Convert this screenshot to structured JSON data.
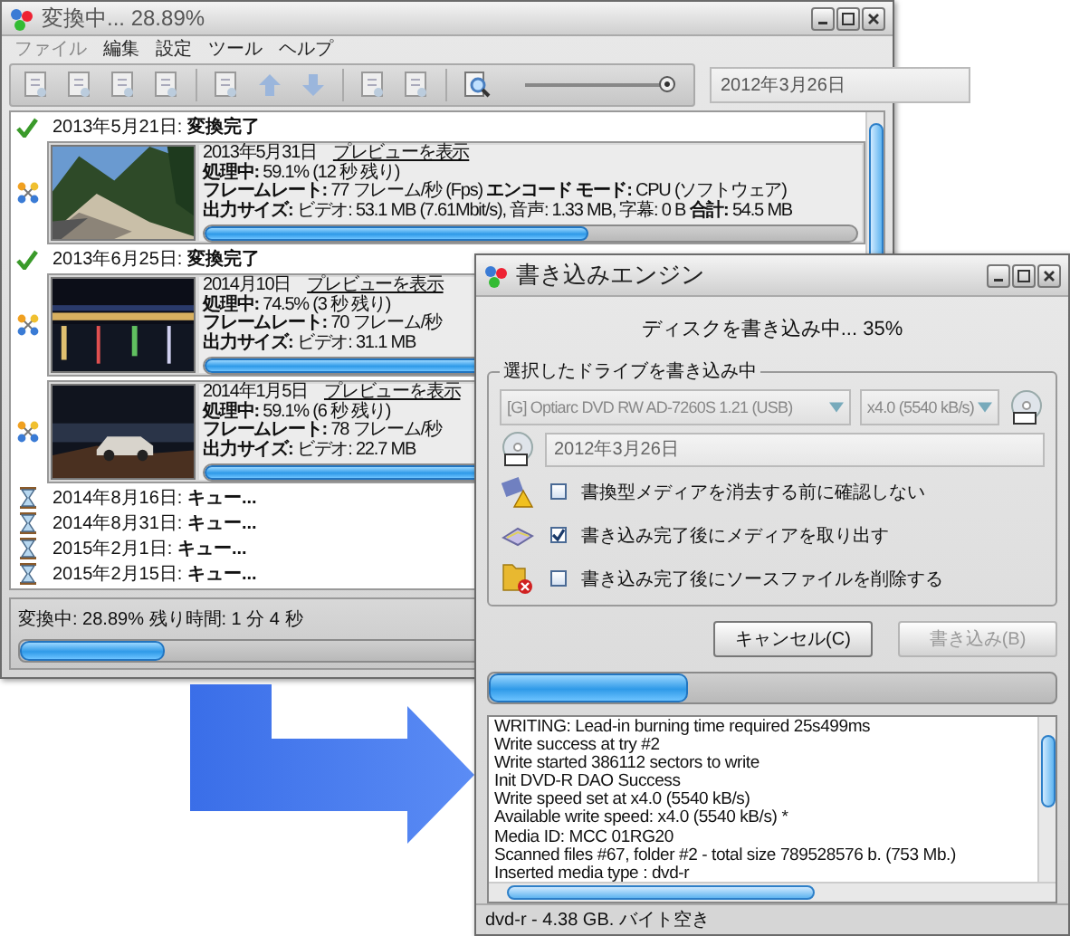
{
  "main_window": {
    "title": "変換中... 28.89%",
    "menu": [
      {
        "label": "ファイル",
        "disabled": true
      },
      {
        "label": "編集",
        "disabled": false
      },
      {
        "label": "設定",
        "disabled": false
      },
      {
        "label": "ツール",
        "disabled": false
      },
      {
        "label": "ヘルプ",
        "disabled": false
      }
    ],
    "toolbar": {
      "zoom_slider": {
        "level": 0.95
      },
      "date_field": {
        "value": "2012年3月26日"
      }
    },
    "jobs": [
      {
        "kind": "done",
        "label": "2013年5月21日: **変換完了**"
      },
      {
        "kind": "task",
        "date": "2013年5月31日",
        "link": "プレビューを表示",
        "lines": [
          "**処理中:** 59.1% (12 秒 残り)",
          "**フレームレート:** 77 フレーム/秒 (Fps) **エンコード モード:** CPU (ソフトウェア)",
          "**出力サイズ:** ビデオ: 53.1 MB (7.61Mbit/s), 音声: 1.33 MB, 字幕: 0  B **合計:** 54.5 MB"
        ],
        "level": 0.59
      },
      {
        "kind": "done",
        "label": "2013年6月25日: **変換完了**"
      },
      {
        "kind": "task",
        "date": "2014月10日",
        "link": "プレビューを表示",
        "lines": [
          "**処理中:** 74.5% (3 秒 残り)",
          "**フレームレート:** 70 フレーム/秒",
          "**出力サイズ:** ビデオ: 31.1 MB"
        ],
        "level": 0.745
      },
      {
        "kind": "task",
        "date": "2014年1月5日",
        "link": "プレビューを表示",
        "lines": [
          "**処理中:** 59.1% (6 秒 残り)",
          "**フレームレート:** 78 フレーム/秒",
          "**出力サイズ:** ビデオ: 22.7 MB"
        ],
        "level": 0.59
      },
      {
        "kind": "queued",
        "label": "2014年8月16日: **キュー...**"
      },
      {
        "kind": "queued",
        "label": "2014年8月31日: **キュー...**"
      },
      {
        "kind": "queued",
        "label": "2015年2月1日: **キュー...**"
      },
      {
        "kind": "queued",
        "label": "2015年2月15日: **キュー...**"
      }
    ],
    "status": {
      "text": "変換中: 28.89% 残り時間: 1 分 4 秒",
      "level": 0.17
    }
  },
  "dialog": {
    "title": "書き込みエンジン",
    "message": "ディスクを書き込み中... 35%",
    "group_title": "選択したドライブを書き込み中",
    "drive": "[G] Optiarc DVD RW AD-7260S 1.21 (USB)",
    "speed": "x4.0 (5540 kB/s)",
    "label_field": {
      "value": "2012年3月26日"
    },
    "options": [
      {
        "kind": "erase",
        "label": "書換型メディアを消去する前に確認しない",
        "checked": false
      },
      {
        "kind": "eject",
        "label": "書き込み完了後にメディアを取り出す",
        "checked": true
      },
      {
        "kind": "delete",
        "label": "書き込み完了後にソースファイルを削除する",
        "checked": false
      }
    ],
    "buttons": [
      {
        "label": "キャンセル(C)",
        "disabled": false
      },
      {
        "label": "書き込み(B)",
        "disabled": true
      }
    ],
    "progress": {
      "level": 0.35
    },
    "log": [
      "WRITING: Lead-in burning time required 25s499ms",
      "Write success at try #2",
      "Write started 386112 sectors to write",
      "Init DVD-R DAO Success",
      "Write speed set at x4.0 (5540 kB/s)",
      "Available write speed: x4.0 (5540 kB/s) *",
      "Media ID: MCC 01RG20",
      "Scanned files #67, folder #2 - total size 789528576 b. (753 Mb.)",
      "Inserted media type : dvd-r"
    ],
    "status": "dvd-r - 4.38 GB. バイト空き"
  }
}
